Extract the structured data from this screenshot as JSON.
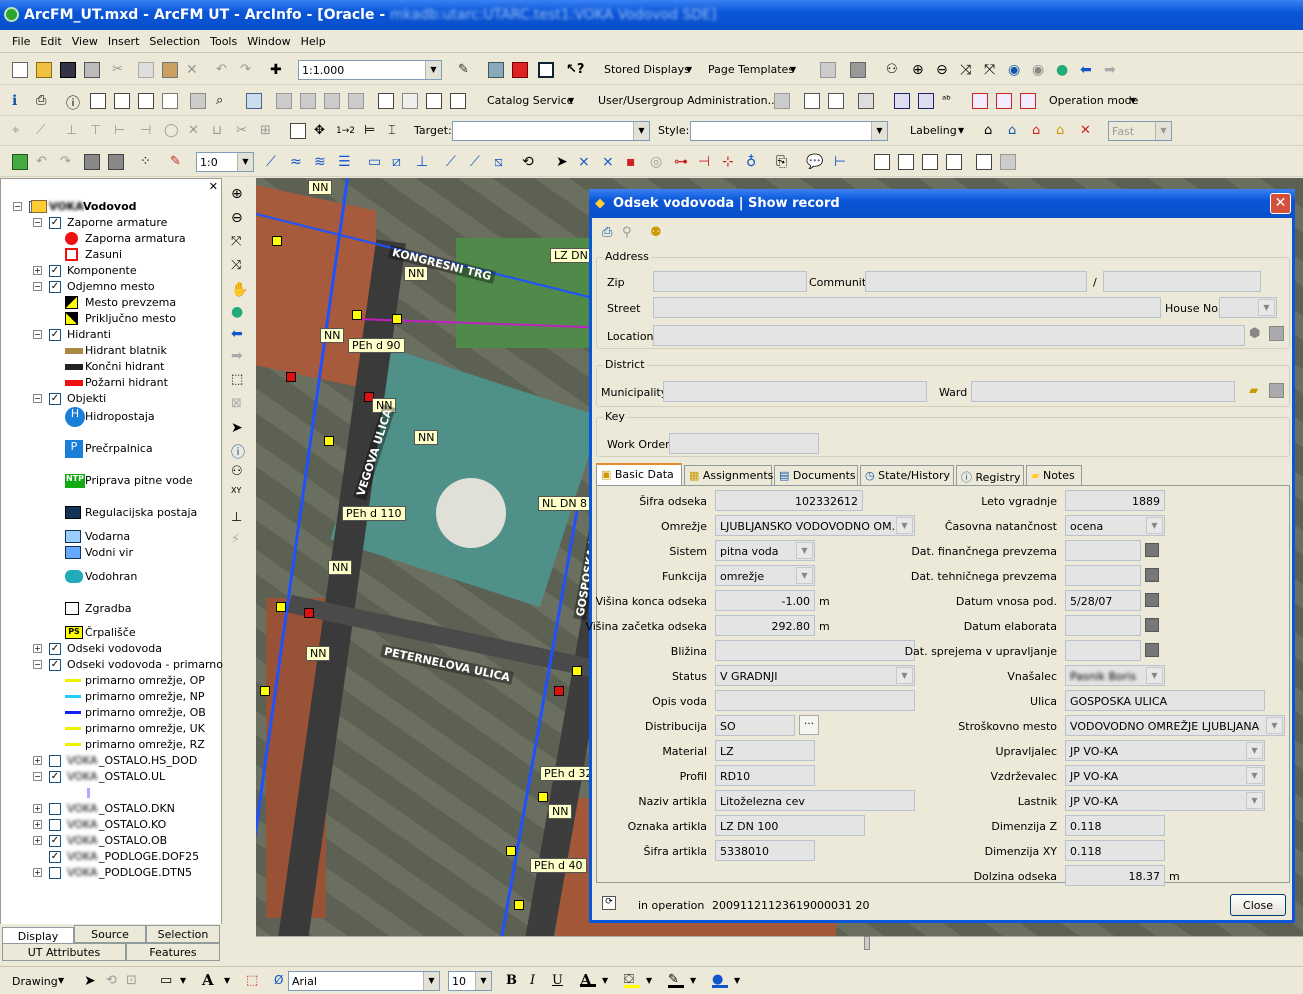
{
  "window": {
    "title": "ArcFM_UT.mxd - ArcFM UT - ArcInfo - [Oracle - ",
    "title_obscured": "mkadb:utarc:UTARC.test1:VOKA Vodovod SDE]"
  },
  "menu": [
    "File",
    "Edit",
    "View",
    "Insert",
    "Selection",
    "Tools",
    "Window",
    "Help"
  ],
  "toolbar1": {
    "scale": "1:1.000",
    "stored_displays": "Stored Displays",
    "page_templates": "Page Templates"
  },
  "toolbar2": {
    "catalog_service": "Catalog Service",
    "user_admin": "User/Usergroup Administration...",
    "operation_mode": "Operation mode"
  },
  "toolbar3": {
    "target_label": "Target:",
    "style_label": "Style:",
    "labeling": "Labeling",
    "fast": "Fast"
  },
  "toolbar4": {
    "ratio": "1:0"
  },
  "toc": {
    "root": "Vodovod",
    "root_prefix": "VOKA",
    "items": [
      {
        "label": "Zaporne armature"
      },
      {
        "label": "Zaporna armatura"
      },
      {
        "label": "Zasuni"
      },
      {
        "label": "Komponente"
      },
      {
        "label": "Odjemno mesto"
      },
      {
        "label": "Mesto prevzema"
      },
      {
        "label": "Priključno mesto"
      },
      {
        "label": "Hidranti"
      },
      {
        "label": "Hidrant blatnik"
      },
      {
        "label": "Končni hidrant"
      },
      {
        "label": "Požarni hidrant"
      },
      {
        "label": "Objekti"
      },
      {
        "label": "Hidropostaja"
      },
      {
        "label": "Prečrpalnica"
      },
      {
        "label": "Priprava pitne vode"
      },
      {
        "label": "Regulacijska postaja"
      },
      {
        "label": "Vodarna"
      },
      {
        "label": "Vodni vir"
      },
      {
        "label": "Vodohran"
      },
      {
        "label": "Zgradba"
      },
      {
        "label": "Črpališče"
      },
      {
        "label": "Odseki vodovoda"
      },
      {
        "label": "Odseki vodovoda - primarno"
      },
      {
        "label": "primarno omrežje, OP"
      },
      {
        "label": "primarno omrežje, NP"
      },
      {
        "label": "primarno omrežje, OB"
      },
      {
        "label": "primarno omrežje, UK"
      },
      {
        "label": "primarno omrežje, RZ"
      },
      {
        "label": "_OSTALO.HS_DOD"
      },
      {
        "label": "_OSTALO.UL"
      },
      {
        "label": "_OSTALO.DKN"
      },
      {
        "label": "_OSTALO.KO"
      },
      {
        "label": "_OSTALO.OB"
      },
      {
        "label": "_PODLOGE.DOF25"
      },
      {
        "label": "_PODLOGE.DTN5"
      }
    ],
    "layer_prefix": "VOKA",
    "sym_text": {
      "h": "H",
      "p": "P",
      "ntp": "NTP",
      "ps": "PS"
    }
  },
  "toc_tabs": [
    "Display",
    "Source",
    "Selection",
    "UT Attributes",
    "Features"
  ],
  "map_labels": [
    "NN",
    "LZ DN",
    "NN",
    "NN",
    "PEh d 90",
    "NN",
    "NN",
    "NL DN 8",
    "PEh d 110",
    "NN",
    "NN",
    "PEh d 32",
    "NN",
    "PEh d 40",
    "KONGRESNI TRG",
    "VEGOVA ULICA",
    "GOSPOSKA ULICA",
    "PETERNELOVA ULICA"
  ],
  "dialog": {
    "title": "Odsek vodovoda | Show record",
    "address": "Address",
    "zip": "Zip",
    "community": "Community",
    "slash": "/",
    "street": "Street",
    "house_no": "House No.",
    "location": "Location",
    "district": "District",
    "municipality": "Municipality",
    "ward": "Ward",
    "key": "Key",
    "work_order": "Work Order",
    "tabs": [
      "Basic Data",
      "Assignments",
      "Documents",
      "State/History",
      "Registry",
      "Notes"
    ],
    "fields_left": [
      {
        "label": "Šifra odseka",
        "value": "102332612"
      },
      {
        "label": "Omrežje",
        "value": "LJUBLJANSKO VODOVODNO OM..."
      },
      {
        "label": "Sistem",
        "value": "pitna voda"
      },
      {
        "label": "Funkcija",
        "value": "omrežje"
      },
      {
        "label": "Višina konca odseka",
        "value": "-1.00"
      },
      {
        "label": "Višina začetka odseka",
        "value": "292.80"
      },
      {
        "label": "Bližina",
        "value": ""
      },
      {
        "label": "Status",
        "value": "V GRADNJI"
      },
      {
        "label": "Opis voda",
        "value": ""
      },
      {
        "label": "Distribucija",
        "value": "SO"
      },
      {
        "label": "Material",
        "value": "LZ"
      },
      {
        "label": "Profil",
        "value": "RD10"
      },
      {
        "label": "Naziv artikla",
        "value": "Litoželezna cev"
      },
      {
        "label": "Oznaka artikla",
        "value": "LZ DN 100"
      },
      {
        "label": "Šifra artikla",
        "value": "5338010"
      }
    ],
    "unit_m": "m",
    "fields_right": [
      {
        "label": "Leto vgradnje",
        "value": "1889"
      },
      {
        "label": "Časovna natančnost",
        "value": "ocena"
      },
      {
        "label": "Dat. finančnega prevzema",
        "value": ""
      },
      {
        "label": "Dat. tehničnega prevzema",
        "value": ""
      },
      {
        "label": "Datum vnosa pod.",
        "value": "5/28/07"
      },
      {
        "label": "Datum elaborata",
        "value": ""
      },
      {
        "label": "Dat. sprejema v upravljanje",
        "value": ""
      },
      {
        "label": "Vnašalec",
        "value": "Pasnik Boris"
      },
      {
        "label": "Ulica",
        "value": "GOSPOSKA ULICA"
      },
      {
        "label": "Stroškovno mesto",
        "value": "VODOVODNO OMREŽJE LJUBLJANA"
      },
      {
        "label": "Upravljalec",
        "value": "JP VO-KA"
      },
      {
        "label": "Vzdrževalec",
        "value": "JP VO-KA"
      },
      {
        "label": "Lastnik",
        "value": "JP VO-KA"
      },
      {
        "label": "Dimenzija Z",
        "value": "0.118"
      },
      {
        "label": "Dimenzija XY",
        "value": "0.118"
      },
      {
        "label": "Dolzina odseka",
        "value": "18.37"
      }
    ],
    "status_text": "in operation",
    "record_id": "20091121123619000031 20",
    "close": "Close"
  },
  "bottom": {
    "drawing": "Drawing",
    "font": "Arial",
    "size": "10",
    "bold": "B",
    "italic": "I",
    "underline": "U",
    "font_color": "A",
    "text_tool": "A"
  }
}
